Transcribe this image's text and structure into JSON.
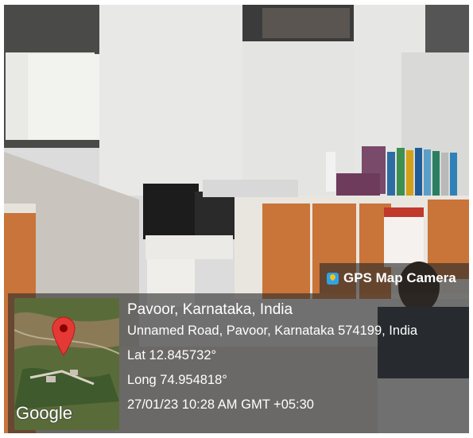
{
  "camera_badge": {
    "label": "GPS Map Camera",
    "icon": "gps-map-camera-app-icon"
  },
  "location": {
    "place": "Pavoor, Karnataka, India",
    "address": "Unnamed Road, Pavoor, Karnataka 574199, India",
    "latitude": "Lat 12.845732°",
    "longitude": "Long 74.954818°",
    "datetime": "27/01/23 10:28 AM GMT +05:30"
  },
  "map": {
    "attribution": "Google",
    "pin_color": "#e53935"
  },
  "colors": {
    "panel_bg": "#2d2d2d",
    "text": "#ffffff"
  }
}
